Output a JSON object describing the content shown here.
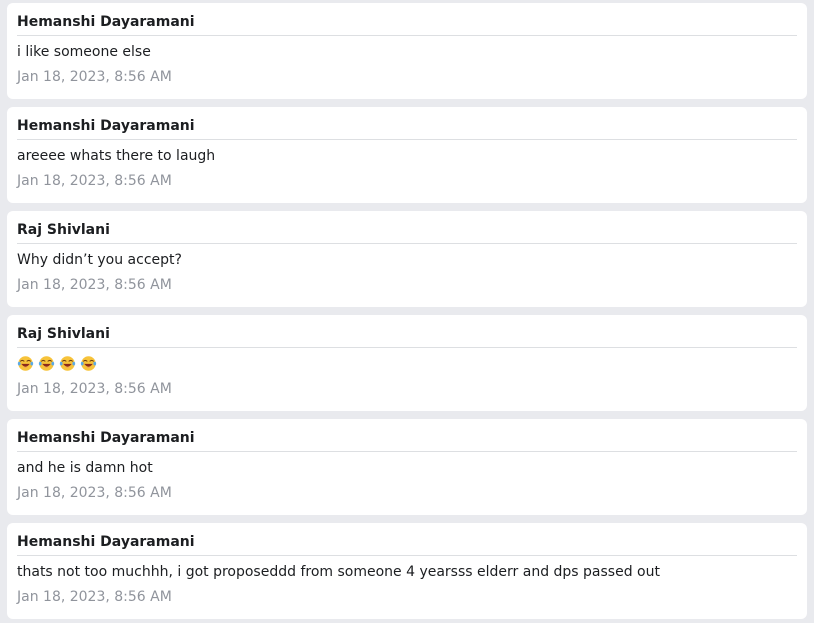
{
  "messages": [
    {
      "sender": "Hemanshi Dayaramani",
      "text": "i like someone else",
      "timestamp": "Jan 18, 2023, 8:56 AM"
    },
    {
      "sender": "Hemanshi Dayaramani",
      "text": "areeee whats there to laugh",
      "timestamp": "Jan 18, 2023, 8:56 AM"
    },
    {
      "sender": "Raj Shivlani",
      "text": "Why didn’t you accept?",
      "timestamp": "Jan 18, 2023, 8:56 AM"
    },
    {
      "sender": "Raj Shivlani",
      "emojis": [
        "laughing-tears-emoji",
        "laughing-tears-emoji",
        "laughing-tears-emoji",
        "laughing-tears-emoji"
      ],
      "timestamp": "Jan 18, 2023, 8:56 AM"
    },
    {
      "sender": "Hemanshi Dayaramani",
      "text": "and he is damn hot",
      "timestamp": "Jan 18, 2023, 8:56 AM"
    },
    {
      "sender": "Hemanshi Dayaramani",
      "text": "thats not too muchhh, i got proposeddd from someone 4 yearsss elderr and dps passed out",
      "timestamp": "Jan 18, 2023, 8:56 AM"
    }
  ]
}
